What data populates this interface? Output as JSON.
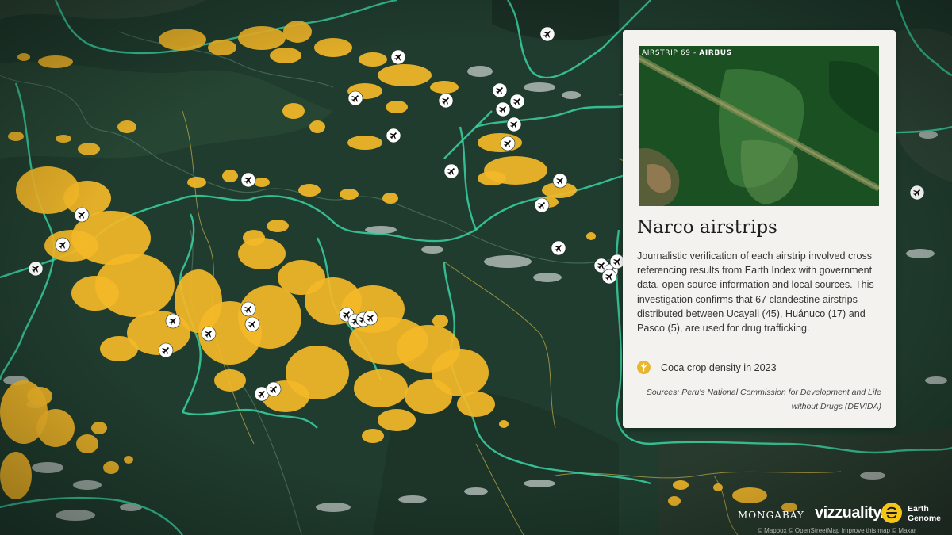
{
  "panel": {
    "photo_label_prefix": "AIRSTRIP 69 - ",
    "photo_label_source": "AIRBUS",
    "title": "Narco airstrips",
    "description": "Journalistic verification of each airstrip involved cross referencing results from Earth Index with government data, open source information and local sources. This investigation confirms that 67 clandestine airstrips distributed between Ucayali (45), Huánuco (17) and Pasco (5), are used for drug trafficking.",
    "legend_label": "Coca crop density in 2023",
    "sources": "Sources: Peru's National Commission for Development and Life without Drugs (DEVIDA)"
  },
  "logos": {
    "mongabay": "MONGABAY",
    "vizzuality": "vizzuality.",
    "earth_genome": "Earth Genome"
  },
  "attribution": "© Mapbox © OpenStreetMap Improve this map © Maxar",
  "colors": {
    "coca": "#f4b928",
    "border_primary": "#3ad3a3",
    "border_secondary": "#c9b24a",
    "panel_bg": "#f3f2ef",
    "map_bg": "#1f3a2d"
  },
  "icons": {
    "airstrip": "airplane-icon",
    "legend": "coca-leaf-icon"
  }
}
